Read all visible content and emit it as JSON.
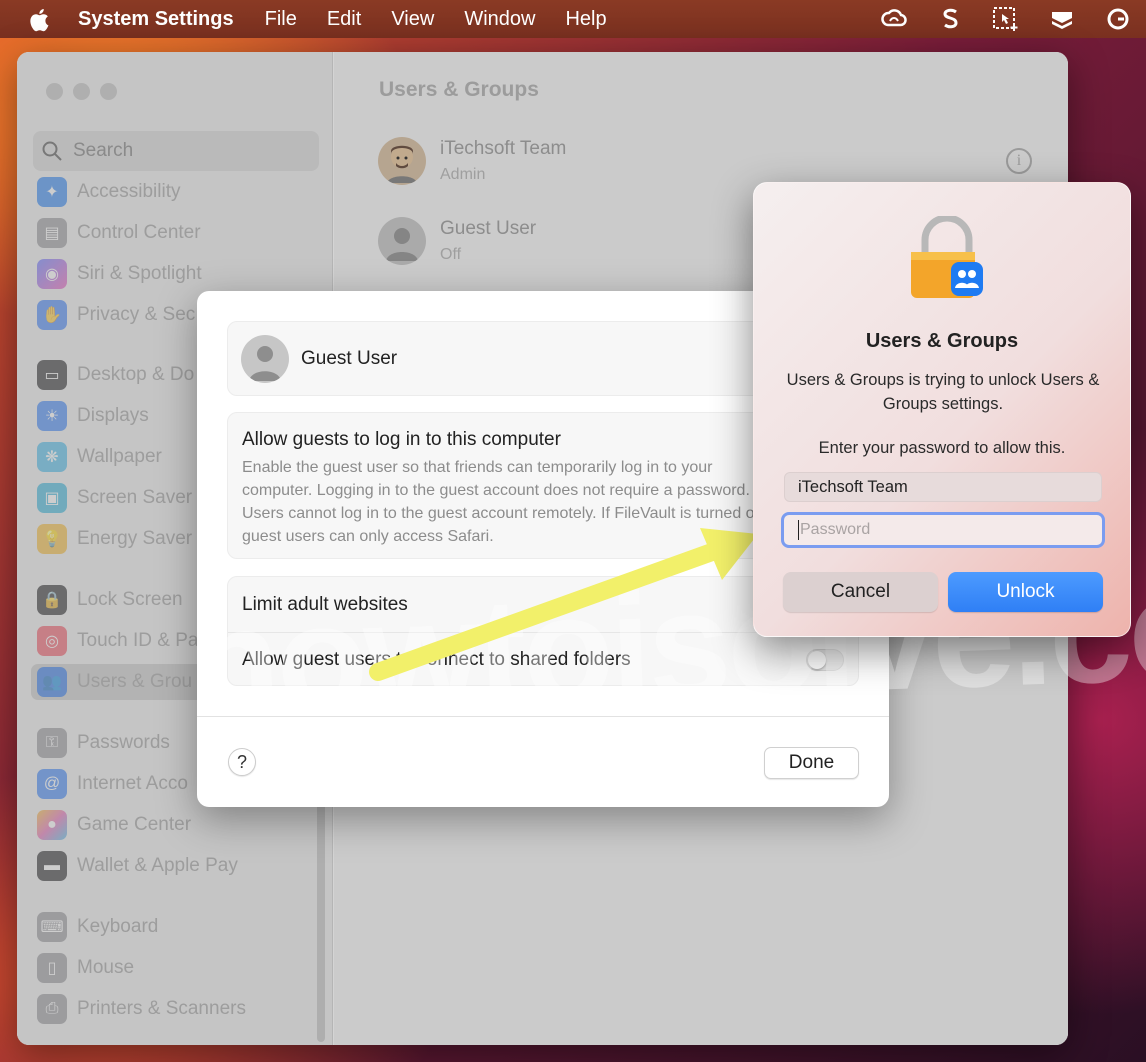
{
  "menubar": {
    "app_name": "System Settings",
    "menus": [
      "File",
      "Edit",
      "View",
      "Window",
      "Help"
    ],
    "status_icons": [
      "creative-cloud-icon",
      "s-app-icon",
      "screenshot-icon",
      "stack-icon",
      "grammarly-icon"
    ]
  },
  "sidebar": {
    "search_placeholder": "Search",
    "items": [
      {
        "label": "Accessibility",
        "icon": "accessibility-icon",
        "color": "#1e7cf2"
      },
      {
        "label": "Control Center",
        "icon": "control-center-icon",
        "color": "#8e8e93"
      },
      {
        "label": "Siri & Spotlight",
        "icon": "siri-icon",
        "color": "#c044d6"
      },
      {
        "label": "Privacy & Sec",
        "icon": "hand-icon",
        "color": "#3478f6"
      },
      {
        "label": "Desktop & Do",
        "icon": "desktop-icon",
        "color": "#1c1c1e"
      },
      {
        "label": "Displays",
        "icon": "displays-icon",
        "color": "#2e7cf6"
      },
      {
        "label": "Wallpaper",
        "icon": "wallpaper-icon",
        "color": "#3db7e8"
      },
      {
        "label": "Screen Saver",
        "icon": "screen-saver-icon",
        "color": "#2ab0d8"
      },
      {
        "label": "Energy Saver",
        "icon": "energy-icon",
        "color": "#f5b52a"
      },
      {
        "label": "Lock Screen",
        "icon": "lock-screen-icon",
        "color": "#1c1c1e"
      },
      {
        "label": "Touch ID & Pa",
        "icon": "fingerprint-icon",
        "color": "#f04a5a"
      },
      {
        "label": "Users & Grou",
        "icon": "users-icon",
        "color": "#2e7cf6"
      },
      {
        "label": "Passwords",
        "icon": "key-icon",
        "color": "#8e8e93"
      },
      {
        "label": "Internet Acco",
        "icon": "at-icon",
        "color": "#2e7cf6"
      },
      {
        "label": "Game Center",
        "icon": "game-center-icon",
        "color": "#e35fb0"
      },
      {
        "label": "Wallet & Apple Pay",
        "icon": "wallet-icon",
        "color": "#1c1c1e"
      },
      {
        "label": "Keyboard",
        "icon": "keyboard-icon",
        "color": "#8e8e93"
      },
      {
        "label": "Mouse",
        "icon": "mouse-icon",
        "color": "#8e8e93"
      },
      {
        "label": "Printers & Scanners",
        "icon": "printer-icon",
        "color": "#8e8e93"
      }
    ]
  },
  "main": {
    "title": "Users & Groups",
    "users": [
      {
        "name": "iTechsoft Team",
        "role": "Admin"
      },
      {
        "name": "Guest User",
        "role": "Off"
      }
    ]
  },
  "sheet": {
    "user_name": "Guest User",
    "allow_title": "Allow guests to log in to this computer",
    "allow_desc": "Enable the guest user so that friends can temporarily log in to your computer. Logging in to the guest account does not require a password. Users cannot log in to the guest account remotely. If FileVault is turned on, guest users can only access Safari.",
    "options": [
      {
        "label": "Limit adult websites"
      },
      {
        "label": "Allow guest users to connect to shared folders",
        "enabled": false
      }
    ],
    "help_label": "?",
    "done_label": "Done"
  },
  "auth_dialog": {
    "title": "Users & Groups",
    "message": "Users & Groups is trying to unlock Users & Groups settings.",
    "prompt": "Enter your password to allow this.",
    "username": "iTechsoft Team",
    "password_placeholder": "Password",
    "cancel_label": "Cancel",
    "unlock_label": "Unlock",
    "accent": "#2f7ff5"
  },
  "watermark": "howtoisolve.com"
}
